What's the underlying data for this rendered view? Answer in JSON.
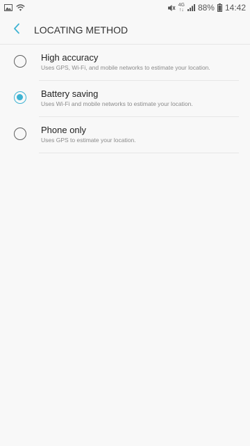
{
  "status_bar": {
    "icons_left": [
      "gallery-icon",
      "wifi-icon"
    ],
    "icons_right": [
      "mute-icon",
      "signal-icon"
    ],
    "network_top": "4G",
    "network_bottom": "↑↓",
    "battery": "88%",
    "time": "14:42"
  },
  "header": {
    "title": "LOCATING METHOD",
    "back_icon": "chevron-left-icon"
  },
  "colors": {
    "accent": "#3eb3d3",
    "background": "#f8f8f8"
  },
  "options": [
    {
      "title": "High accuracy",
      "description": "Uses GPS, Wi-Fi, and mobile networks to estimate your location.",
      "selected": false
    },
    {
      "title": "Battery saving",
      "description": "Uses Wi-Fi and mobile networks to estimate your location.",
      "selected": true
    },
    {
      "title": "Phone only",
      "description": "Uses GPS to estimate your location.",
      "selected": false
    }
  ]
}
